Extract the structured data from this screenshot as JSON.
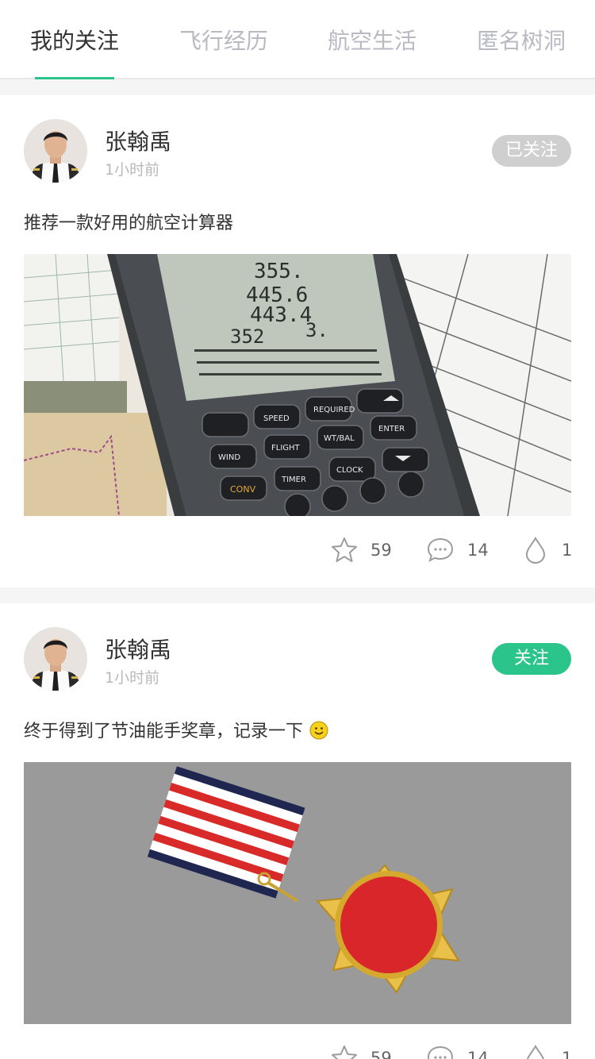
{
  "tabs": [
    {
      "label": "我的关注",
      "active": true
    },
    {
      "label": "飞行经历",
      "active": false
    },
    {
      "label": "航空生活",
      "active": false
    },
    {
      "label": "匿名树洞",
      "active": false
    }
  ],
  "colors": {
    "accent": "#2bc48a",
    "followed_bg": "#cfcfcf",
    "tab_inactive": "#b9b9c4"
  },
  "posts": [
    {
      "author": "张翰禹",
      "time": "1小时前",
      "follow_label": "已关注",
      "follow_state": "followed",
      "text": "推荐一款好用的航空计算器",
      "image": "flight-calculator-photo",
      "likes": "59",
      "comments": "14",
      "drops": "1"
    },
    {
      "author": "张翰禹",
      "time": "1小时前",
      "follow_label": "关注",
      "follow_state": "not-followed",
      "text": "终于得到了节油能手奖章，记录一下",
      "image": "medal-photo",
      "likes": "59",
      "comments": "14",
      "drops": "1"
    }
  ],
  "icons": [
    "star-icon",
    "comment-icon",
    "drop-icon",
    "smiley-icon"
  ]
}
